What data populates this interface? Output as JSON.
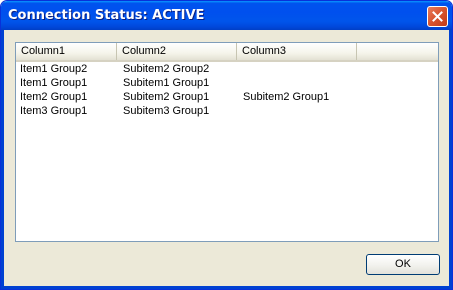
{
  "window": {
    "title": "Connection Status: ACTIVE"
  },
  "listview": {
    "columns": [
      "Column1",
      "Column2",
      "Column3",
      ""
    ],
    "rows": [
      [
        "Item1 Group2",
        "Subitem2 Group2",
        ""
      ],
      [
        "Item1 Group1",
        "Subitem1 Group1",
        ""
      ],
      [
        "Item2 Group1",
        "Subitem2 Group1",
        "Subitem2 Group1"
      ],
      [
        "Item3 Group1",
        "Subitem3 Group1",
        ""
      ]
    ]
  },
  "buttons": {
    "ok_label": "OK"
  },
  "icons": {
    "close": "close-icon"
  },
  "colors": {
    "titlebar": "#0053ee",
    "dialog_bg": "#ece9d8",
    "close_button": "#d7532e"
  }
}
